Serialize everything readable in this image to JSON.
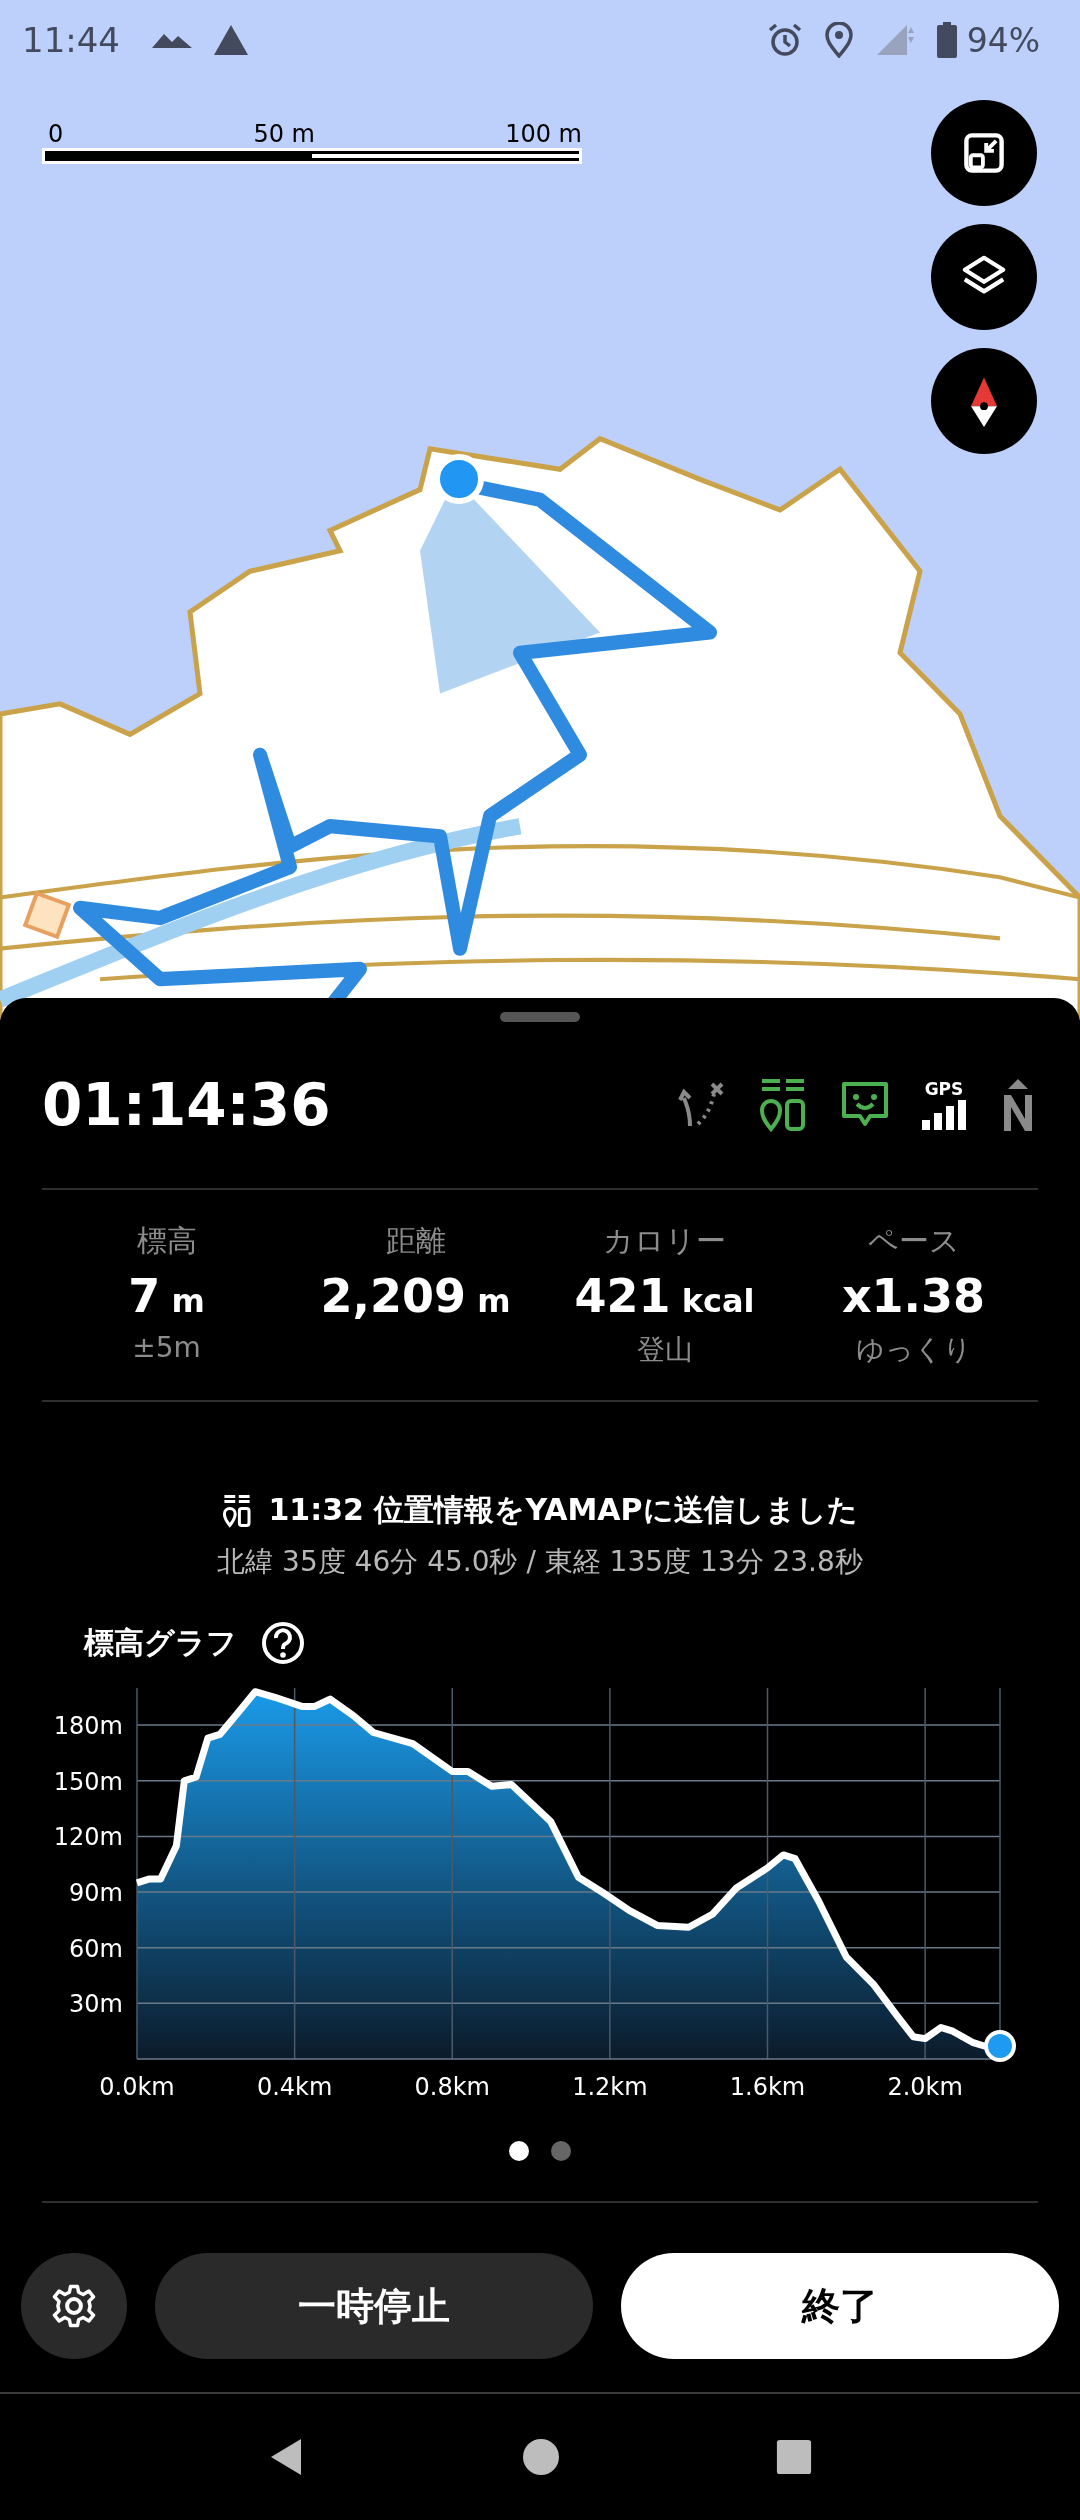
{
  "status_bar": {
    "time": "11:44",
    "battery": "94%"
  },
  "map": {
    "scale_labels": [
      "0",
      "50 m",
      "100 m"
    ]
  },
  "tracking": {
    "elapsed": "01:14:36",
    "indicators": [
      {
        "kind": "route",
        "active": false
      },
      {
        "kind": "share",
        "active": true
      },
      {
        "kind": "chat",
        "active": true
      },
      {
        "kind": "gps",
        "label": "GPS",
        "active": true
      },
      {
        "kind": "north",
        "active": false
      }
    ]
  },
  "stats": [
    {
      "label": "標高",
      "value": "7",
      "unit": "m",
      "sub": "±5m"
    },
    {
      "label": "距離",
      "value": "2,209",
      "unit": "m"
    },
    {
      "label": "カロリー",
      "value": "421",
      "unit": "kcal",
      "sub": "登山"
    },
    {
      "label": "ペース",
      "value": "x1.38",
      "sub": "ゆっくり"
    }
  ],
  "message": {
    "text": "11:32 位置情報をYAMAPに送信しました",
    "coords": "北緯 35度 46分 45.0秒 / 東経 135度 13分 23.8秒"
  },
  "elevation_graph": {
    "title": "標高グラフ",
    "chart_data": {
      "type": "area",
      "x": [
        0,
        0.03,
        0.06,
        0.1,
        0.12,
        0.15,
        0.18,
        0.21,
        0.25,
        0.3,
        0.35,
        0.42,
        0.45,
        0.49,
        0.55,
        0.6,
        0.7,
        0.8,
        0.84,
        0.9,
        0.95,
        1.0,
        1.05,
        1.12,
        1.18,
        1.25,
        1.32,
        1.4,
        1.46,
        1.52,
        1.6,
        1.64,
        1.67,
        1.73,
        1.8,
        1.87,
        1.93,
        1.97,
        2.0,
        2.04,
        2.07,
        2.12,
        2.15,
        2.19
      ],
      "grid": true,
      "series": [
        {
          "color": "#1a9ae8",
          "values": [
            95,
            97,
            97,
            115,
            150,
            152,
            173,
            175,
            185,
            198,
            195,
            190,
            190,
            194,
            185,
            176,
            170,
            155,
            155,
            147,
            148,
            138,
            128,
            98,
            90,
            80,
            72,
            71,
            78,
            92,
            103,
            110,
            108,
            85,
            55,
            40,
            23,
            12,
            11,
            17,
            15,
            9,
            7,
            7
          ]
        }
      ],
      "xlim": [
        0,
        2.19
      ],
      "ylim": [
        0,
        200
      ],
      "xticks": [
        {
          "value": 0,
          "label": "0.0km"
        },
        {
          "value": 0.4,
          "label": "0.4km"
        },
        {
          "value": 0.8,
          "label": "0.8km"
        },
        {
          "value": 1.2,
          "label": "1.2km"
        },
        {
          "value": 1.6,
          "label": "1.6km"
        },
        {
          "value": 2.0,
          "label": "2.0km"
        }
      ],
      "yticks": [
        {
          "value": 30,
          "label": "30m"
        },
        {
          "value": 60,
          "label": "60m"
        },
        {
          "value": 90,
          "label": "90m"
        },
        {
          "value": 120,
          "label": "120m"
        },
        {
          "value": 150,
          "label": "150m"
        },
        {
          "value": 180,
          "label": "180m"
        }
      ]
    }
  },
  "pages": [
    {
      "selected": true
    },
    {
      "selected": false
    }
  ],
  "buttons": {
    "pause": "一時停止",
    "finish": "終了"
  }
}
